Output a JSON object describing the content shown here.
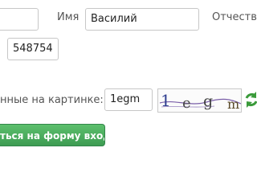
{
  "form": {
    "first_field": {
      "value": ""
    },
    "name_label": "Имя",
    "name_field": {
      "value": "Василий"
    },
    "patronymic_label": "Отчество",
    "code_field": {
      "value": "548754"
    },
    "captcha_label": "нные на картинке:",
    "captcha_input": {
      "value": "1egm"
    },
    "captcha_image": {
      "text": "1 e g m",
      "chars": [
        "1",
        "e",
        "g",
        "m"
      ],
      "colors": [
        "#2e3d8f",
        "#4a4a4a",
        "#444444",
        "#5a4a2a"
      ],
      "noise_color": "#7a5ea8"
    },
    "refresh_icon": "refresh-arrows-icon",
    "refresh_color": "#3a9a3a",
    "submit_label": "ться на форму входа",
    "submit_color": "#47a65a"
  }
}
